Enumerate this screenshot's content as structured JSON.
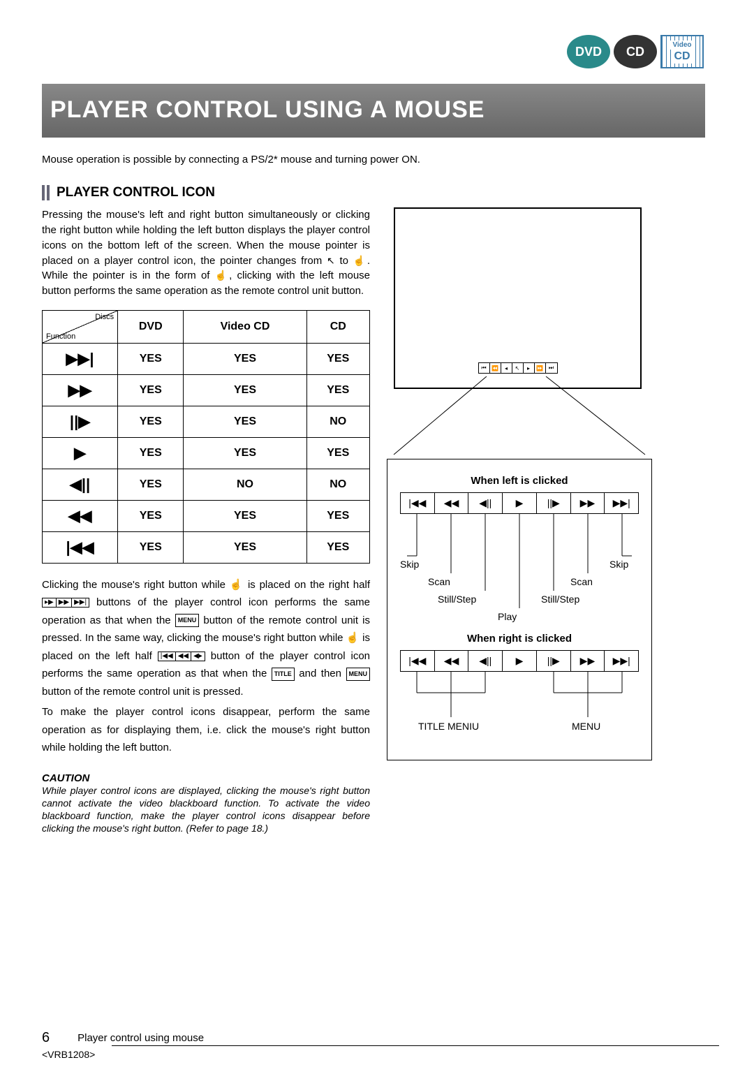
{
  "logos": {
    "dvd": "DVD",
    "cd": "CD",
    "vcd_top": "Video",
    "vcd_bot": "CD"
  },
  "title": "PLAYER CONTROL USING A MOUSE",
  "intro": "Mouse operation is possible by connecting a PS/2* mouse and turning power ON.",
  "subhead": "PLAYER CONTROL ICON",
  "para1a": "Pressing the mouse's left and right button simultaneously or clicking the right button while holding the left button displays the player control icons on the bottom left of the screen. When the mouse pointer is placed on a player control icon, the pointer changes from ",
  "para1b": " to ",
  "para1c": ". While the pointer is in the form of ",
  "para1d": ", clicking with the left mouse button performs the same operation as the remote control unit button.",
  "table": {
    "hdr_discs": "Discs",
    "hdr_function": "Function",
    "cols": [
      "DVD",
      "Video CD",
      "CD"
    ],
    "rows": [
      {
        "icon": "▶▶|",
        "vals": [
          "YES",
          "YES",
          "YES"
        ]
      },
      {
        "icon": "▶▶",
        "vals": [
          "YES",
          "YES",
          "YES"
        ]
      },
      {
        "icon": "||▶",
        "vals": [
          "YES",
          "YES",
          "NO"
        ]
      },
      {
        "icon": "▶",
        "vals": [
          "YES",
          "YES",
          "YES"
        ]
      },
      {
        "icon": "◀||",
        "vals": [
          "YES",
          "NO",
          "NO"
        ]
      },
      {
        "icon": "◀◀",
        "vals": [
          "YES",
          "YES",
          "YES"
        ]
      },
      {
        "icon": "|◀◀",
        "vals": [
          "YES",
          "YES",
          "YES"
        ]
      }
    ]
  },
  "para2_parts": {
    "a": "Clicking the mouse's right button while ",
    "b": " is placed on the right half ",
    "c": " buttons of the player control icon performs the same operation as that when the ",
    "d": " button of the remote control unit is pressed. In the same way, clicking the mouse's right button while ",
    "e": " is placed on the left half ",
    "f": " button of the player control icon performs the same operation as that when the ",
    "g": " and then ",
    "h": " button of the remote control unit is pressed.",
    "tail1": "To make the player control icons disappear, perform the same operation as for displaying them, i.e. click the mouse's right button while holding the left button."
  },
  "inline_btns": {
    "right_half": [
      "▸▶",
      "▶▶",
      "▶▶|"
    ],
    "left_half": [
      "|◀◀",
      "◀◀",
      "◀▸"
    ],
    "menu": "MENU",
    "title": "TITLE"
  },
  "caution_hdr": "CAUTION",
  "caution": "While player control icons are displayed, clicking the mouse's right button cannot activate the video blackboard function. To activate the video blackboard function, make the player control icons disappear before clicking the mouse's right button. (Refer to page 18.)",
  "strip_icons": [
    "|◀◀",
    "◀◀",
    "◀||",
    "▶",
    "||▶",
    "▶▶",
    "▶▶|"
  ],
  "diag": {
    "t_left": "When left is clicked",
    "labels_left": {
      "skip_l": "Skip",
      "scan_l": "Scan",
      "still_l": "Still/Step",
      "play": "Play",
      "still_r": "Still/Step",
      "scan_r": "Scan",
      "skip_r": "Skip"
    },
    "t_right": "When right is clicked",
    "labels_right": {
      "title": "TITLE MENIU",
      "menu": "MENU"
    }
  },
  "footer": {
    "page": "6",
    "caption": "Player control using mouse"
  },
  "doc_id": "<VRB1208>"
}
